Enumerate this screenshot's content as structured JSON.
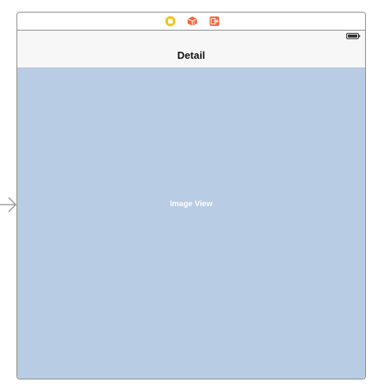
{
  "scene": {
    "dock": {
      "icons": [
        "view-controller-icon",
        "first-responder-icon",
        "exit-icon"
      ]
    },
    "navigation_bar": {
      "title": "Detail",
      "status_icon": "battery-icon"
    },
    "image_view": {
      "label": "Image View",
      "background": "#b8cce4"
    }
  },
  "colors": {
    "view_controller_icon": "#f5c518",
    "object_icons": "#f0693e",
    "nav_bar_bg": "#f7f7f7",
    "frame_border": "#8a8a8a"
  }
}
